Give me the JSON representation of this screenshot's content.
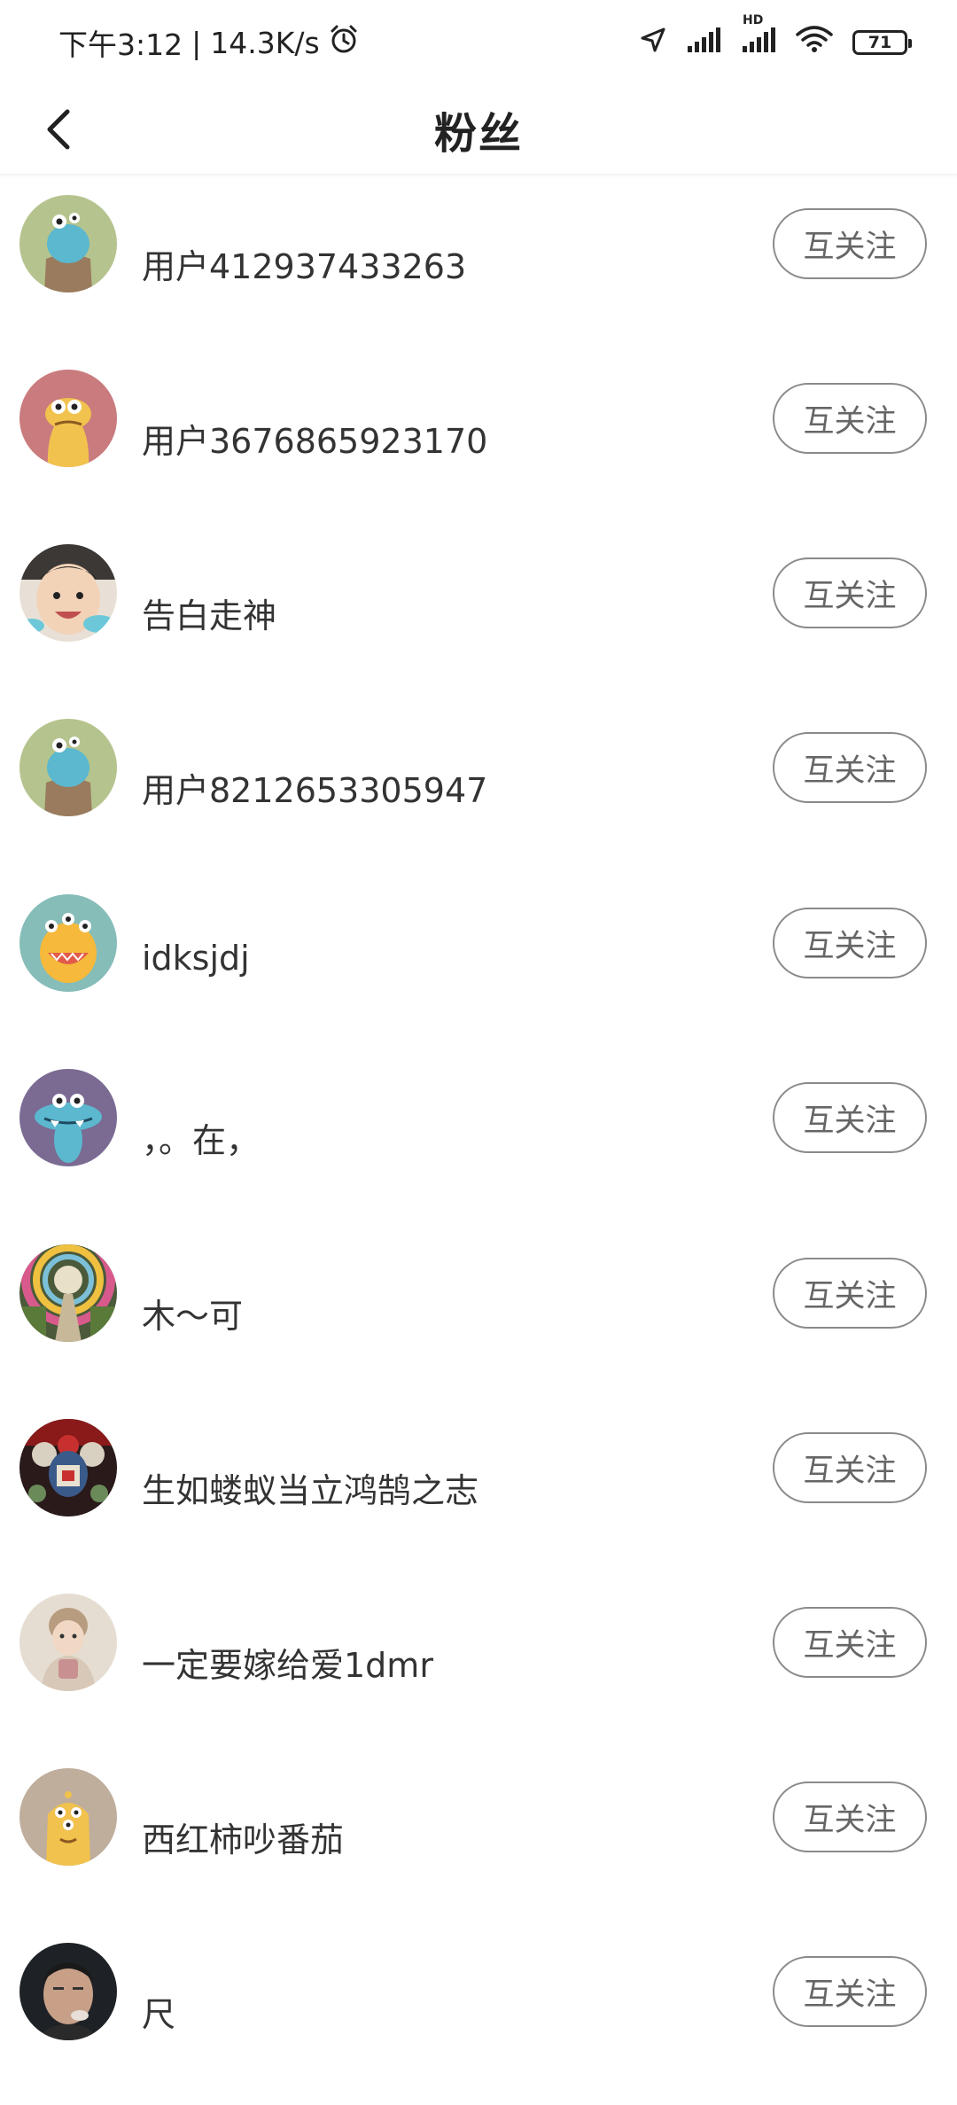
{
  "status_bar": {
    "time": "下午3:12",
    "speed": "14.3K/s",
    "battery": "71",
    "network_label": "HD"
  },
  "header": {
    "title": "粉丝"
  },
  "fans": [
    {
      "name": "用户412937433263",
      "button": "互关注",
      "avatar": "blue-monster"
    },
    {
      "name": "用户3676865923170",
      "button": "互关注",
      "avatar": "yellow-monster-pink"
    },
    {
      "name": "告白走神",
      "button": "互关注",
      "avatar": "baby-photo"
    },
    {
      "name": "用户8212653305947",
      "button": "互关注",
      "avatar": "blue-monster"
    },
    {
      "name": "idksjdj",
      "button": "互关注",
      "avatar": "orange-monster-teal"
    },
    {
      "name": "，。在，",
      "button": "互关注",
      "avatar": "blue-monster-purple"
    },
    {
      "name": "木～可",
      "button": "互关注",
      "avatar": "tunnel-photo"
    },
    {
      "name": "生如蝼蚁当立鸿鹄之志",
      "button": "互关注",
      "avatar": "opera-photo"
    },
    {
      "name": "一定要嫁给爱1dmr",
      "button": "互关注",
      "avatar": "girl-photo"
    },
    {
      "name": "西红柿吵番茄",
      "button": "互关注",
      "avatar": "yellow-monster-taupe"
    },
    {
      "name": "尺",
      "button": "互关注",
      "avatar": "man-photo"
    }
  ]
}
